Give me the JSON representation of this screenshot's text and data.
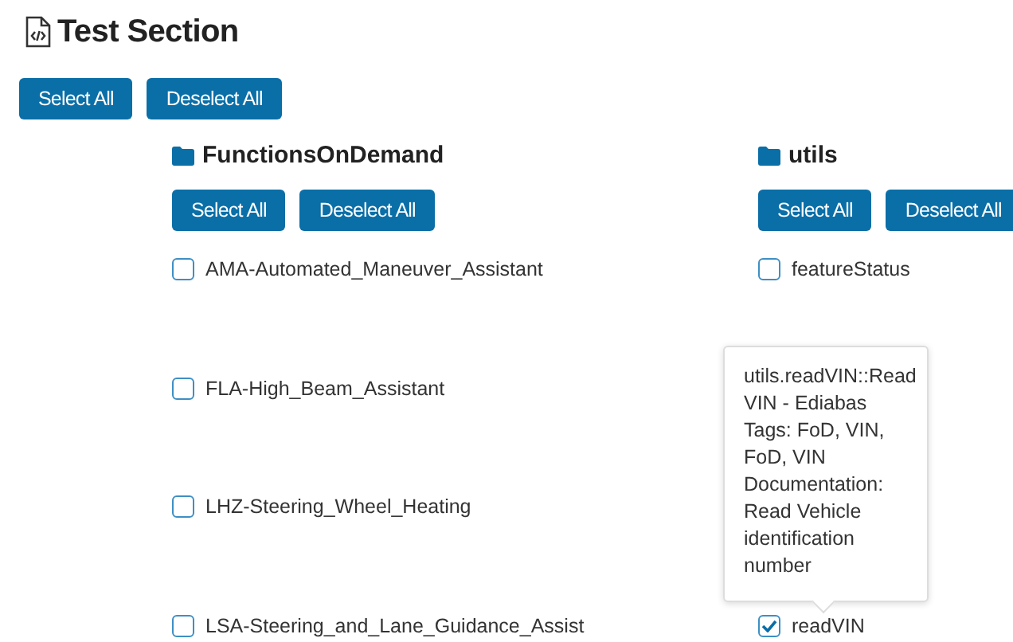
{
  "section": {
    "title": "Test Section",
    "buttons": [
      "Select All",
      "Deselect All"
    ]
  },
  "groups": [
    {
      "name": "FunctionsOnDemand",
      "buttons": [
        "Select All",
        "Deselect All"
      ],
      "items": [
        {
          "label": "AMA-Automated_Maneuver_Assistant",
          "checked": false
        },
        {
          "label": "FLA-High_Beam_Assistant",
          "checked": false
        },
        {
          "label": "LHZ-Steering_Wheel_Heating",
          "checked": false
        },
        {
          "label": "LSA-Steering_and_Lane_Guidance_Assist",
          "checked": false
        }
      ]
    },
    {
      "name": "utils",
      "buttons": [
        "Select All",
        "Deselect All"
      ],
      "items": [
        {
          "label": "featureStatus",
          "checked": false
        },
        {
          "label": "readVIN",
          "checked": true
        }
      ]
    }
  ],
  "tooltip": {
    "lines": [
      "utils.readVIN::Read VIN - Ediabas",
      "Tags: FoD, VIN, FoD, VIN",
      "Documentation: Read Vehicle identification number"
    ]
  }
}
